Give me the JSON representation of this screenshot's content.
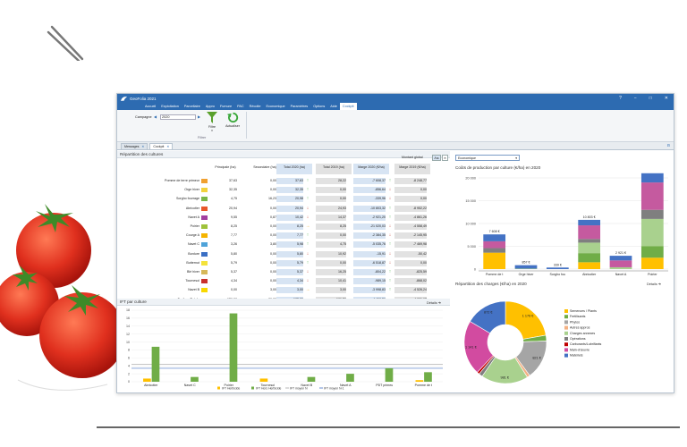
{
  "app": {
    "title": "GeoFolia 2021",
    "window_controls": [
      "?",
      "−",
      "□",
      "✕"
    ],
    "menu": [
      "Accueil",
      "Exploitation",
      "Parcellaire",
      "Appro",
      "Fumure",
      "PAC",
      "Récolte",
      "Economique",
      "Paramètres",
      "Options",
      "Aide",
      "Cockpit"
    ],
    "active_menu": "Cockpit"
  },
  "ribbon": {
    "campagne_label": "Campagne",
    "campagne_value": "2020",
    "filtre_label": "Filtre",
    "filtre_group": "Filtrer",
    "refresh_label": "Actualiser"
  },
  "tabs": [
    {
      "label": "Messages",
      "active": false
    },
    {
      "label": "Cockpit",
      "active": true
    }
  ],
  "repartition": {
    "title": "Répartition des cultures",
    "montant_label": "Montant global",
    "ha_btn": "/ha",
    "right_select": "Economique",
    "headers": [
      "Principale (ha)",
      "Secondaire (ha)",
      "Total 2020 (ha)",
      "Total 2019 (ha)",
      "Marge 2020 (€/ha)",
      "Marge 2019 (€/ha)"
    ],
    "rows": [
      {
        "name": "Pomme de terre primeur",
        "color": "#f0a030",
        "p": "37,63",
        "s": "0,00",
        "t20": "37,63",
        "a1": "up",
        "t19": "28,22",
        "m20": "-7 608,37",
        "a2": "up",
        "m19": "-8 248,77"
      },
      {
        "name": "Orge hiver",
        "color": "#f2d23c",
        "p": "32,35",
        "s": "0,00",
        "t20": "32,35",
        "a1": "up",
        "t19": "0,00",
        "m20": "-856,64",
        "a2": "down",
        "m19": "0,00"
      },
      {
        "name": "Sorgho fourrage",
        "color": "#7ab648",
        "p": "4,75",
        "s": "16,23",
        "t20": "20,98",
        "a1": "up",
        "t19": "0,00",
        "m20": "-339,96",
        "a2": "down",
        "m19": "0,00"
      },
      {
        "name": "Abricotier",
        "color": "#e8572a",
        "p": "20,94",
        "s": "0,00",
        "t20": "20,94",
        "a1": "down",
        "t19": "24,93",
        "m20": "-10 803,32",
        "a2": "up",
        "m19": "-8 952,22"
      },
      {
        "name": "Navet A",
        "color": "#a23fa0",
        "p": "9,55",
        "s": "0,87",
        "t20": "10,42",
        "a1": "down",
        "t19": "14,37",
        "m20": "-2 921,20",
        "a2": "up",
        "m19": "-4 861,26"
      },
      {
        "name": "Poirier",
        "color": "#9ec23a",
        "p": "8,25",
        "s": "0,00",
        "t20": "8,25",
        "a1": "right",
        "t19": "8,25",
        "m20": "-21 020,03",
        "a2": "down",
        "m19": "-4 558,49"
      },
      {
        "name": "Courge A",
        "color": "#f5b400",
        "p": "7,77",
        "s": "0,00",
        "t20": "7,77",
        "a1": "up",
        "t19": "0,00",
        "m20": "-2 384,35",
        "a2": "down",
        "m19": "-2 145,95"
      },
      {
        "name": "Navet C",
        "color": "#4fa3d9",
        "p": "3,26",
        "s": "3,80",
        "t20": "5,98",
        "a1": "up",
        "t19": "4,75",
        "m20": "-5 035,76",
        "a2": "up",
        "m19": "-7 469,98"
      },
      {
        "name": "Bordure",
        "color": "#3b6fc4",
        "p": "5,80",
        "s": "0,00",
        "t20": "5,80",
        "a1": "down",
        "t19": "10,92",
        "m20": "-15,91",
        "a2": "down",
        "m19": "-50,42"
      },
      {
        "name": "Butternut",
        "color": "#f4e23a",
        "p": "5,79",
        "s": "0,00",
        "t20": "5,79",
        "a1": "up",
        "t19": "0,00",
        "m20": "-6 518,87",
        "a2": "down",
        "m19": "0,00"
      },
      {
        "name": "Blé hiver",
        "color": "#d6b85a",
        "p": "5,37",
        "s": "0,00",
        "t20": "5,37",
        "a1": "down",
        "t19": "16,25",
        "m20": "-804,22",
        "a2": "up",
        "m19": "-825,59"
      },
      {
        "name": "Tournesol",
        "color": "#c9302c",
        "p": "4,34",
        "s": "0,00",
        "t20": "4,34",
        "a1": "down",
        "t19": "10,41",
        "m20": "-989,15",
        "a2": "up",
        "m19": "-868,02"
      },
      {
        "name": "Navet B",
        "color": "#f8d800",
        "p": "0,00",
        "s": "3,00",
        "t20": "3,00",
        "a1": "right",
        "t19": "3,00",
        "m20": "-3 998,83",
        "a2": "up",
        "m19": "-4 526,24"
      }
    ],
    "total": {
      "name": "Surface Totale",
      "p": "152,96",
      "s": "32,90",
      "t20": "185,86",
      "t19": "161,76",
      "m20": "-4 406,52",
      "m19": "-4 331,27"
    }
  },
  "couts": {
    "title": "Coûts de production par culture (€/ha) en 2020",
    "chart_data": {
      "type": "bar",
      "categories": [
        "Pomme de t",
        "Orge hiver",
        "Sorgho fou",
        "Abricotier",
        "Navet A",
        "Poirier"
      ],
      "totals": [
        7608,
        857,
        339,
        10803,
        2921,
        21020
      ],
      "total_labels": [
        "7 608 €",
        "857 €",
        "339 €",
        "10 803 €",
        "2 921 €",
        "21 020 €"
      ],
      "series": [
        {
          "color": "#ffc000",
          "values": [
            3600,
            0,
            0,
            1500,
            0,
            2500
          ]
        },
        {
          "color": "#70ad47",
          "values": [
            0,
            0,
            0,
            2000,
            0,
            2500
          ]
        },
        {
          "color": "#a9d18e",
          "values": [
            0,
            100,
            0,
            2300,
            400,
            6000
          ]
        },
        {
          "color": "#7f7f7f",
          "values": [
            1000,
            0,
            0,
            800,
            0,
            2000
          ]
        },
        {
          "color": "#c55a9f",
          "values": [
            1500,
            0,
            0,
            3000,
            1500,
            6000
          ]
        },
        {
          "color": "#4472c4",
          "values": [
            1508,
            757,
            339,
            1203,
            1021,
            2020
          ]
        }
      ],
      "ylim": [
        0,
        20000
      ],
      "yticks": [
        "0",
        "5 000",
        "10 000",
        "15 000",
        "20 000"
      ]
    }
  },
  "charges": {
    "title": "Répartition des charges (€/ha) en 2020",
    "details": "Détails",
    "chart_data": {
      "type": "pie",
      "slices": [
        {
          "label": "Semences / Plants",
          "value": 1176,
          "color": "#ffc000",
          "display": "1 176 €"
        },
        {
          "label": "Fertilisants",
          "value": 120,
          "color": "#70ad47",
          "display": ""
        },
        {
          "label": "Phytos",
          "value": 821,
          "color": "#a5a5a5",
          "display": "821 €"
        },
        {
          "label": "Autres appros",
          "value": 60,
          "color": "#f4b183",
          "display": ""
        },
        {
          "label": "Charges annexes",
          "value": 981,
          "color": "#a9d18e",
          "display": "981 €"
        },
        {
          "label": "Opérations",
          "value": 80,
          "color": "#7f7f7f",
          "display": ""
        },
        {
          "label": "Carburants/Lubrifiants",
          "value": 50,
          "color": "#c00000",
          "display": ""
        },
        {
          "label": "Main-d'œuvre",
          "value": 1141,
          "color": "#d24ba0",
          "display": "1 141 €"
        },
        {
          "label": "Matériels",
          "value": 872,
          "color": "#4472c4",
          "display": "872 €"
        }
      ],
      "center_labels": [
        "1 150 €"
      ]
    }
  },
  "ift": {
    "title": "IFT par culture",
    "details": "Détails",
    "chart_data": {
      "type": "bar",
      "categories": [
        "Abricotier",
        "Navet C",
        "Poirier",
        "Tournesol",
        "Navet B",
        "Navet A",
        "PDT primeu",
        "Pomme de t"
      ],
      "series": [
        {
          "name": "IFT Herbicide",
          "color": "#ffc000",
          "values": [
            0.8,
            0,
            0,
            0.8,
            0,
            0,
            0,
            0.4
          ]
        },
        {
          "name": "IFT Hors Herbicide",
          "color": "#70ad47",
          "values": [
            8.8,
            1.2,
            17.2,
            0,
            1.2,
            2.0,
            3.4,
            2.4
          ]
        }
      ],
      "lines": [
        {
          "name": "IFT moyen N",
          "color": "#a5a5a5",
          "value": 4.4
        },
        {
          "name": "IFT moyen N-1",
          "color": "#4472c4",
          "value": 3.4
        }
      ],
      "ylim": [
        0,
        18
      ],
      "yticks": [
        "0",
        "2",
        "4",
        "6",
        "8",
        "10",
        "12",
        "14",
        "16",
        "18"
      ]
    }
  }
}
